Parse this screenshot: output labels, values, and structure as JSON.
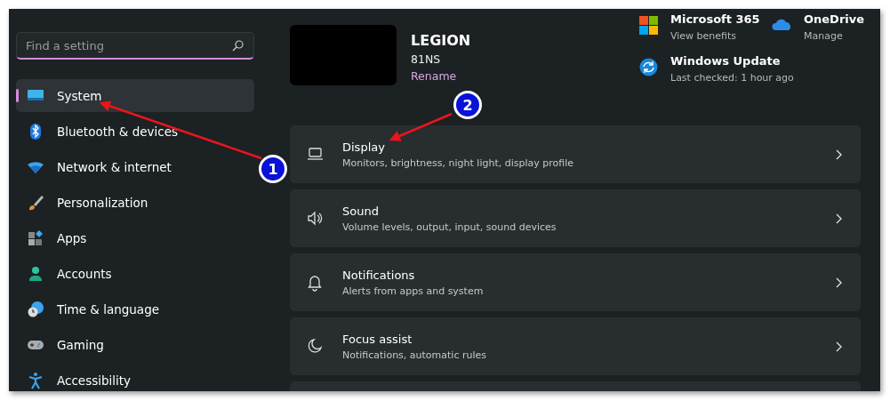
{
  "search": {
    "placeholder": "Find a setting"
  },
  "sidebar": {
    "items": [
      {
        "label": "System",
        "selected": true
      },
      {
        "label": "Bluetooth & devices",
        "selected": false
      },
      {
        "label": "Network & internet",
        "selected": false
      },
      {
        "label": "Personalization",
        "selected": false
      },
      {
        "label": "Apps",
        "selected": false
      },
      {
        "label": "Accounts",
        "selected": false
      },
      {
        "label": "Time & language",
        "selected": false
      },
      {
        "label": "Gaming",
        "selected": false
      },
      {
        "label": "Accessibility",
        "selected": false
      }
    ]
  },
  "device": {
    "name": "LEGION",
    "model": "81NS",
    "rename": "Rename"
  },
  "quick_links": [
    {
      "title": "Microsoft 365",
      "subtitle": "View benefits"
    },
    {
      "title": "OneDrive",
      "subtitle": "Manage"
    },
    {
      "title": "Windows Update",
      "subtitle": "Last checked: 1 hour ago"
    }
  ],
  "settings": [
    {
      "title": "Display",
      "subtitle": "Monitors, brightness, night light, display profile"
    },
    {
      "title": "Sound",
      "subtitle": "Volume levels, output, input, sound devices"
    },
    {
      "title": "Notifications",
      "subtitle": "Alerts from apps and system"
    },
    {
      "title": "Focus assist",
      "subtitle": "Notifications, automatic rules"
    }
  ],
  "annotations": [
    {
      "label": "1"
    },
    {
      "label": "2"
    }
  ]
}
